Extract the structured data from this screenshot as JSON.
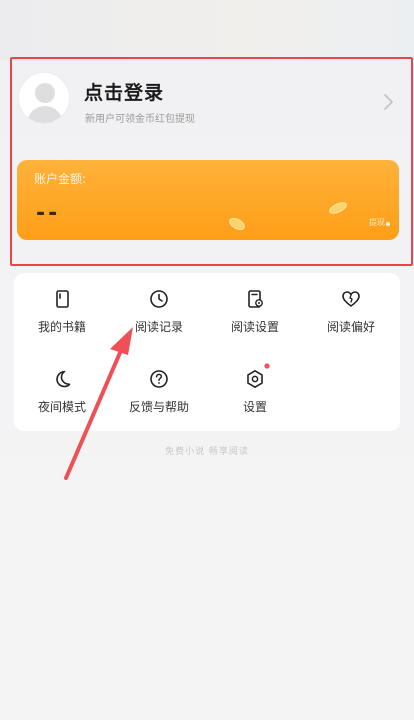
{
  "profile": {
    "login_title": "点击登录",
    "login_subtitle": "新用户可领金币红包提现"
  },
  "balance": {
    "label": "账户金额:",
    "value": "--",
    "withdraw_label": "提现"
  },
  "menu": {
    "items": [
      {
        "label": "我的书籍",
        "icon": "book-icon"
      },
      {
        "label": "阅读记录",
        "icon": "clock-icon"
      },
      {
        "label": "阅读设置",
        "icon": "phone-settings-icon"
      },
      {
        "label": "阅读偏好",
        "icon": "heart-icon"
      },
      {
        "label": "夜间模式",
        "icon": "moon-icon"
      },
      {
        "label": "反馈与帮助",
        "icon": "help-icon"
      },
      {
        "label": "设置",
        "icon": "gear-hex-icon"
      }
    ]
  },
  "footer": {
    "text": "免费小说 畅享阅读"
  },
  "colors": {
    "accent_orange": "#ff9e18",
    "highlight_red": "#e8464a",
    "badge_red": "#ff4d4f"
  }
}
